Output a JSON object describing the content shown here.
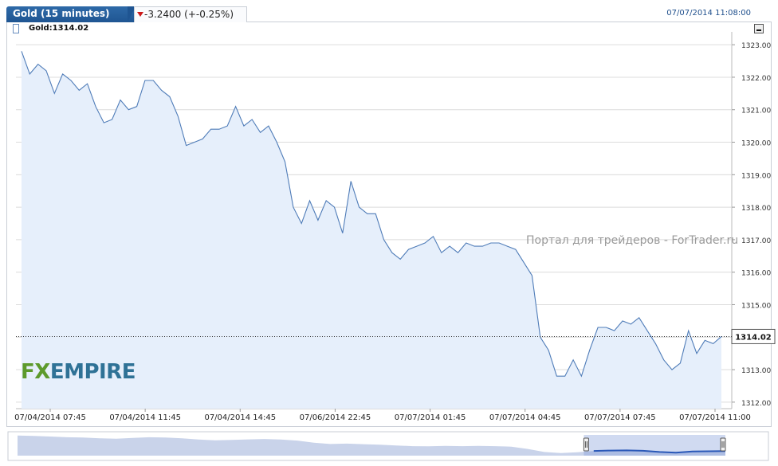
{
  "header": {
    "instrument_tab": "Gold (15 minutes)",
    "change_text": "-3.2400 (+-0.25%)",
    "datetime": "07/07/2014 11:08:00"
  },
  "legend": {
    "label": "Gold:1314.02"
  },
  "watermark": "Портал для трейдеров - ForTrader.ru",
  "logo": {
    "part1": "FX",
    "part2": "EMPIRE"
  },
  "colors": {
    "line": "#4f7cb8",
    "fill": "#e6effb",
    "tab": "#1f5592",
    "down_arrow": "#cc1a1a",
    "navigator": "#2a58b8"
  },
  "icons": {
    "down_arrow": "triangle-down-icon",
    "legend": "series-swatch-icon",
    "minimize": "minimize-icon"
  },
  "chart_data": {
    "type": "area",
    "title": "",
    "series": [
      {
        "name": "Gold",
        "values": [
          1322.8,
          1322.1,
          1322.4,
          1322.2,
          1321.5,
          1322.1,
          1321.9,
          1321.6,
          1321.8,
          1321.1,
          1320.6,
          1320.7,
          1321.3,
          1321.0,
          1321.1,
          1321.9,
          1321.9,
          1321.6,
          1321.4,
          1320.8,
          1319.9,
          1320.0,
          1320.1,
          1320.4,
          1320.4,
          1320.5,
          1321.1,
          1320.5,
          1320.7,
          1320.3,
          1320.5,
          1320.0,
          1319.4,
          1318.0,
          1317.5,
          1318.2,
          1317.6,
          1318.2,
          1318.0,
          1317.2,
          1318.8,
          1318.0,
          1317.8,
          1317.8,
          1317.0,
          1316.6,
          1316.4,
          1316.7,
          1316.8,
          1316.9,
          1317.1,
          1316.6,
          1316.8,
          1316.6,
          1316.9,
          1316.8,
          1316.8,
          1316.9,
          1316.9,
          1316.8,
          1316.7,
          1316.3,
          1315.9,
          1314.0,
          1313.6,
          1312.8,
          1312.8,
          1313.3,
          1312.8,
          1313.6,
          1314.3,
          1314.3,
          1314.2,
          1314.5,
          1314.4,
          1314.6,
          1314.2,
          1313.8,
          1313.3,
          1313.0,
          1313.2,
          1314.2,
          1313.5,
          1313.9,
          1313.8,
          1314.02
        ]
      }
    ],
    "x_tick_labels": [
      "07/04/2014 07:45",
      "07/04/2014 11:45",
      "07/04/2014 14:45",
      "07/06/2014 22:45",
      "07/07/2014 01:45",
      "07/07/2014 04:45",
      "07/07/2014 07:45",
      "07/07/2014 11:00"
    ],
    "y_ticks": [
      1312.0,
      1313.0,
      1314.0,
      1315.0,
      1316.0,
      1317.0,
      1318.0,
      1319.0,
      1320.0,
      1321.0,
      1322.0,
      1323.0
    ],
    "y_tick_labels": [
      "1312.00",
      "1313.00",
      "1314.00",
      "1315.00",
      "1316.00",
      "1317.00",
      "1318.00",
      "1319.00",
      "1320.00",
      "1321.00",
      "1322.00",
      "1323.00"
    ],
    "ylim": [
      1311.8,
      1323.2
    ],
    "last_value_label": "1314.02",
    "grid": true,
    "legend_position": "top-left",
    "navigator": {
      "values": [
        1322.8,
        1322.5,
        1322.2,
        1321.8,
        1321.6,
        1321.2,
        1321.0,
        1321.4,
        1321.8,
        1321.6,
        1321.2,
        1320.5,
        1320.1,
        1320.3,
        1320.6,
        1320.8,
        1320.5,
        1319.9,
        1318.7,
        1318.0,
        1318.2,
        1317.9,
        1317.6,
        1317.2,
        1316.8,
        1316.7,
        1316.9,
        1316.8,
        1316.9,
        1316.8,
        1316.5,
        1315.2,
        1313.5,
        1312.9,
        1313.4,
        1314.1,
        1314.3,
        1314.4,
        1314.2,
        1313.5,
        1313.1,
        1313.8,
        1313.9,
        1314.02
      ],
      "selected_from_fraction": 0.8,
      "selected_to_fraction": 1.0
    }
  }
}
